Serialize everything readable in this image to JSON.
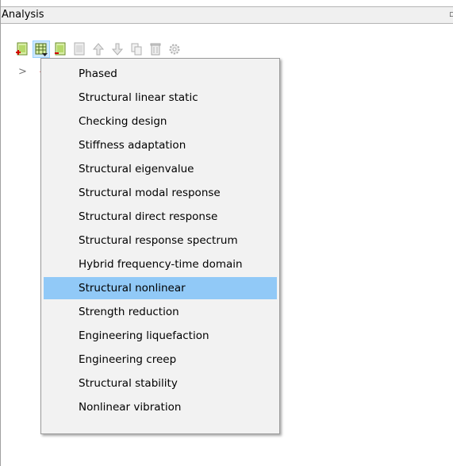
{
  "panel": {
    "title": "Analysis",
    "corner_glyph": "▫"
  },
  "toolbar": {
    "buttons": [
      {
        "name": "add-analysis-icon",
        "icon": "page-plus",
        "active": false
      },
      {
        "name": "add-analysis-dropdown-icon",
        "icon": "page-grid-dropdown",
        "active": true
      },
      {
        "name": "add-command-icon",
        "icon": "page-green",
        "active": false
      },
      {
        "name": "copy-analysis-icon",
        "icon": "page-gray",
        "active": false
      },
      {
        "name": "move-up-icon",
        "icon": "arrow-up",
        "active": false
      },
      {
        "name": "move-down-icon",
        "icon": "arrow-down",
        "active": false
      },
      {
        "name": "duplicate-icon",
        "icon": "copy-pages",
        "active": false
      },
      {
        "name": "delete-icon",
        "icon": "trash",
        "active": false
      },
      {
        "name": "settings-icon",
        "icon": "gear",
        "active": false
      }
    ]
  },
  "tree": {
    "expander": ">",
    "marker": "-"
  },
  "menu": {
    "items": [
      "Phased",
      "Structural linear static",
      "Checking design",
      "Stiffness adaptation",
      "Structural eigenvalue",
      "Structural modal response",
      "Structural direct response",
      "Structural response spectrum",
      "Hybrid frequency-time domain",
      "Structural nonlinear",
      "Strength reduction",
      "Engineering liquefaction",
      "Engineering creep",
      "Structural stability",
      "Nonlinear vibration"
    ],
    "highlighted_index": 9,
    "highlight_color": "#91c9f7"
  }
}
